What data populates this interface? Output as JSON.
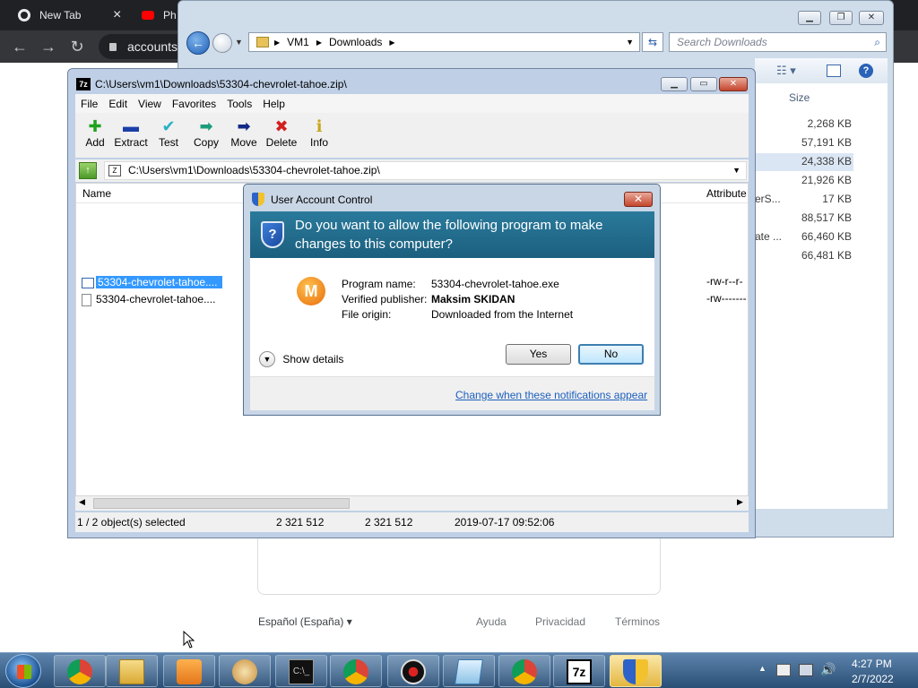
{
  "chrome": {
    "tabs": [
      {
        "label": "New Tab",
        "close": "×"
      },
      {
        "label": "Ph"
      }
    ],
    "address": "accounts"
  },
  "google_page": {
    "language": "Español (España)",
    "links": [
      "Ayuda",
      "Privacidad",
      "Términos"
    ]
  },
  "explorer": {
    "breadcrumb": [
      "VM1",
      "Downloads"
    ],
    "search_placeholder": "Search Downloads",
    "size_header": "Size",
    "sizes": [
      "2,268 KB",
      "57,191 KB",
      "24,338 KB",
      "21,926 KB",
      "17 KB",
      "88,517 KB",
      "66,460 KB",
      "66,481 KB"
    ],
    "partial_labels": [
      "erS...",
      "ate ..."
    ]
  },
  "sevenzip": {
    "title": "C:\\Users\\vm1\\Downloads\\53304-chevrolet-tahoe.zip\\",
    "menu": [
      "File",
      "Edit",
      "View",
      "Favorites",
      "Tools",
      "Help"
    ],
    "toolbar": [
      {
        "label": "Add",
        "icon": "plus-icon",
        "color": "#1fa31f"
      },
      {
        "label": "Extract",
        "icon": "minus-icon",
        "color": "#1a3fa8"
      },
      {
        "label": "Test",
        "icon": "check-icon",
        "color": "#27b3c4"
      },
      {
        "label": "Copy",
        "icon": "copy-arrow-icon",
        "color": "#1c9c7a"
      },
      {
        "label": "Move",
        "icon": "move-arrow-icon",
        "color": "#142a86"
      },
      {
        "label": "Delete",
        "icon": "delete-x-icon",
        "color": "#d21f1f"
      },
      {
        "label": "Info",
        "icon": "info-icon",
        "color": "#c7a61a"
      }
    ],
    "path": "C:\\Users\\vm1\\Downloads\\53304-chevrolet-tahoe.zip\\",
    "columns": {
      "name": "Name",
      "attributes": "Attribute"
    },
    "files": [
      {
        "name": "53304-chevrolet-tahoe....",
        "attr": "-rw-r--r-",
        "selected": true
      },
      {
        "name": "53304-chevrolet-tahoe....",
        "attr": "-rw-------",
        "selected": false
      }
    ],
    "status": {
      "selected": "1 / 2 object(s) selected",
      "size": "2 321 512",
      "packed": "2 321 512",
      "modified": "2019-07-17 09:52:06"
    }
  },
  "uac": {
    "title": "User Account Control",
    "question": "Do you want to allow the following program to make changes to this computer?",
    "labels": {
      "program": "Program name:",
      "publisher": "Verified publisher:",
      "origin": "File origin:"
    },
    "values": {
      "program": "53304-chevrolet-tahoe.exe",
      "publisher": "Maksim SKIDAN",
      "origin": "Downloaded from the Internet"
    },
    "show_details": "Show details",
    "yes": "Yes",
    "no": "No",
    "change_link": "Change when these notifications appear"
  },
  "taskbar": {
    "time": "4:27 PM",
    "date": "2/7/2022",
    "accent": "#2a4f76"
  }
}
